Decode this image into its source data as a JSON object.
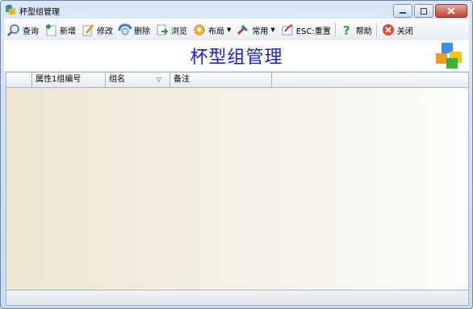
{
  "window": {
    "title": "杯型组管理"
  },
  "toolbar": {
    "query": "查询",
    "add": "新增",
    "edit": "修改",
    "delete": "删除",
    "browse": "浏览",
    "layout": "布局",
    "common": "常用",
    "reset": "ESC:重置",
    "help": "帮助",
    "close": "关闭"
  },
  "header": {
    "title": "杯型组管理"
  },
  "grid": {
    "columns": [
      "",
      "属性1组编号",
      "组名",
      "备注"
    ],
    "rows": []
  },
  "colors": {
    "title_blue": "#1b1bd6",
    "grid_bg": "#ede5cf"
  }
}
